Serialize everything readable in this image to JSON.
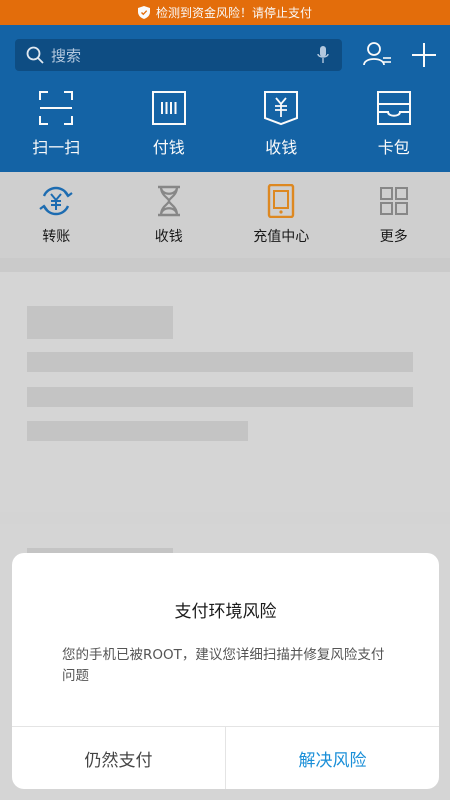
{
  "warning_bar": {
    "text": "检测到资金风险！请停止支付",
    "color": "#e8700c"
  },
  "header": {
    "search_placeholder": "搜索",
    "actions": [
      {
        "label": "扫一扫",
        "icon": "scan-icon"
      },
      {
        "label": "付钱",
        "icon": "pay-code-icon"
      },
      {
        "label": "收钱",
        "icon": "receive-money-icon"
      },
      {
        "label": "卡包",
        "icon": "card-wallet-icon"
      }
    ],
    "background_color": "#1565a9"
  },
  "quick_actions": [
    {
      "label": "转账",
      "icon": "transfer-icon"
    },
    {
      "label": "收钱",
      "icon": "hourglass-icon"
    },
    {
      "label": "充值中心",
      "icon": "phone-recharge-icon"
    },
    {
      "label": "更多",
      "icon": "grid-more-icon"
    }
  ],
  "dialog": {
    "title": "支付环境风险",
    "message": "您的手机已被ROOT，建议您详细扫描并修复风险支付问题",
    "cancel_label": "仍然支付",
    "confirm_label": "解决风险",
    "confirm_color": "#1a8fd8"
  }
}
